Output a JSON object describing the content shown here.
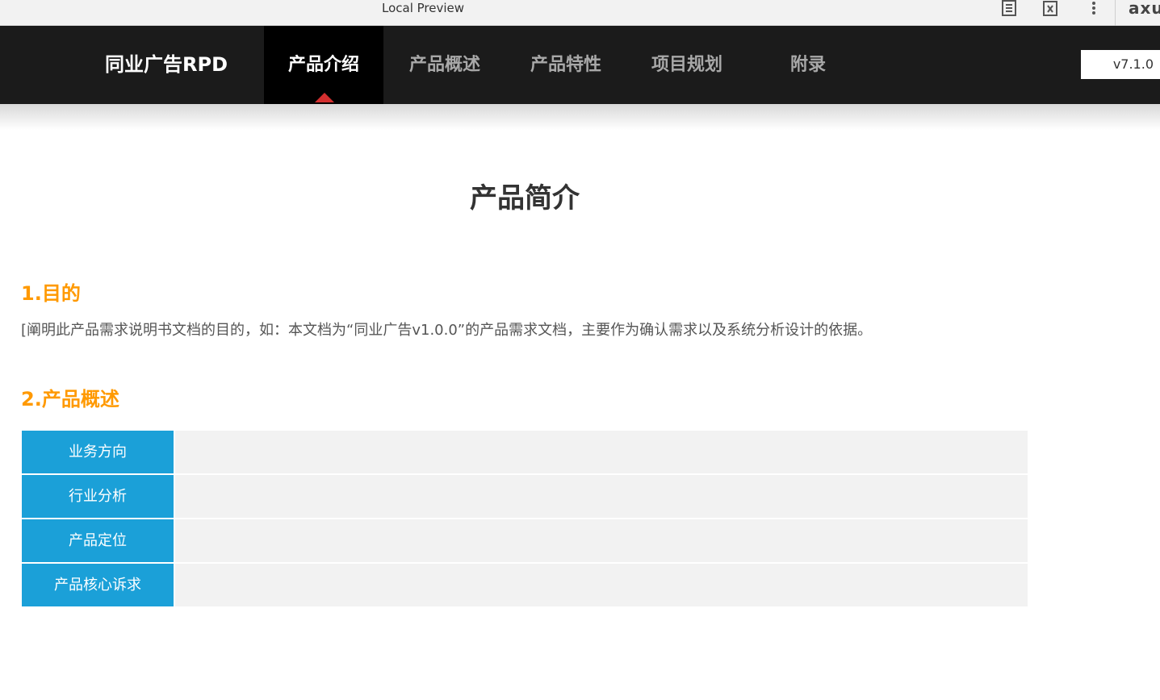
{
  "browser": {
    "title": "Local Preview",
    "logo_text": "axu",
    "icons": [
      "document-icon",
      "variable-icon",
      "more-vert-icon"
    ]
  },
  "nav": {
    "brand": "同业广告RPD",
    "items": [
      {
        "label": "产品介绍",
        "active": true
      },
      {
        "label": "产品概述",
        "active": false
      },
      {
        "label": "产品特性",
        "active": false
      },
      {
        "label": "项目规划",
        "active": false
      },
      {
        "label": "附录",
        "active": false
      }
    ],
    "version": "v7.1.0"
  },
  "page": {
    "title": "产品简介",
    "section1_heading": "1.目的",
    "section1_text": "[阐明此产品需求说明书文档的目的，如：本文档为“同业广告v1.0.0”的产品需求文档，主要作为确认需求以及系统分析设计的依据。",
    "section2_heading": "2.产品概述",
    "table": [
      {
        "label": "业务方向",
        "value": ""
      },
      {
        "label": "行业分析",
        "value": ""
      },
      {
        "label": "产品定位",
        "value": ""
      },
      {
        "label": "产品核心诉求",
        "value": ""
      }
    ]
  },
  "colors": {
    "accent_orange": "#ff9900",
    "table_label_blue": "#1ba0d8",
    "nav_background": "#1b1b1b",
    "active_caret": "#d32f2f"
  }
}
